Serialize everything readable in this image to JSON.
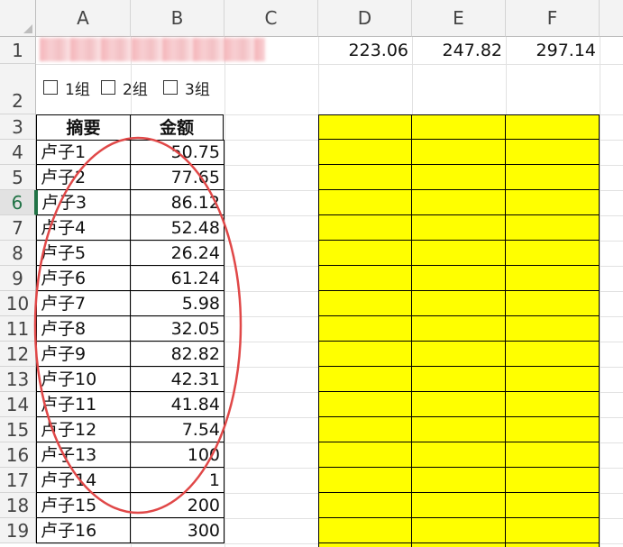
{
  "columns": [
    "A",
    "B",
    "C",
    "D",
    "E",
    "F"
  ],
  "rows": [
    "1",
    "2",
    "3",
    "4",
    "5",
    "6",
    "7",
    "8",
    "9",
    "10",
    "11",
    "12",
    "13",
    "14",
    "15",
    "16",
    "17",
    "18",
    "19"
  ],
  "selected_row": "6",
  "row1_values": {
    "D": "223.06",
    "E": "247.82",
    "F": "297.14"
  },
  "checkboxes": [
    {
      "label": "1组",
      "checked": false
    },
    {
      "label": "2组",
      "checked": false
    },
    {
      "label": "3组",
      "checked": false
    }
  ],
  "table": {
    "headers": {
      "A": "摘要",
      "B": "金额"
    },
    "rows": [
      {
        "name": "卢子1",
        "amount": "50.75"
      },
      {
        "name": "卢子2",
        "amount": "77.65"
      },
      {
        "name": "卢子3",
        "amount": "86.12"
      },
      {
        "name": "卢子4",
        "amount": "52.48"
      },
      {
        "name": "卢子5",
        "amount": "26.24"
      },
      {
        "name": "卢子6",
        "amount": "61.24"
      },
      {
        "name": "卢子7",
        "amount": "5.98"
      },
      {
        "name": "卢子8",
        "amount": "32.05"
      },
      {
        "name": "卢子9",
        "amount": "82.82"
      },
      {
        "name": "卢子10",
        "amount": "42.31"
      },
      {
        "name": "卢子11",
        "amount": "41.84"
      },
      {
        "name": "卢子12",
        "amount": "7.54"
      },
      {
        "name": "卢子13",
        "amount": "100"
      },
      {
        "name": "卢子14",
        "amount": "1"
      },
      {
        "name": "卢子15",
        "amount": "200"
      },
      {
        "name": "卢子16",
        "amount": "300"
      }
    ]
  },
  "colors": {
    "highlight_fill": "#ffff00",
    "annotation_stroke": "#e04848",
    "selected_row_header": "#217346"
  }
}
